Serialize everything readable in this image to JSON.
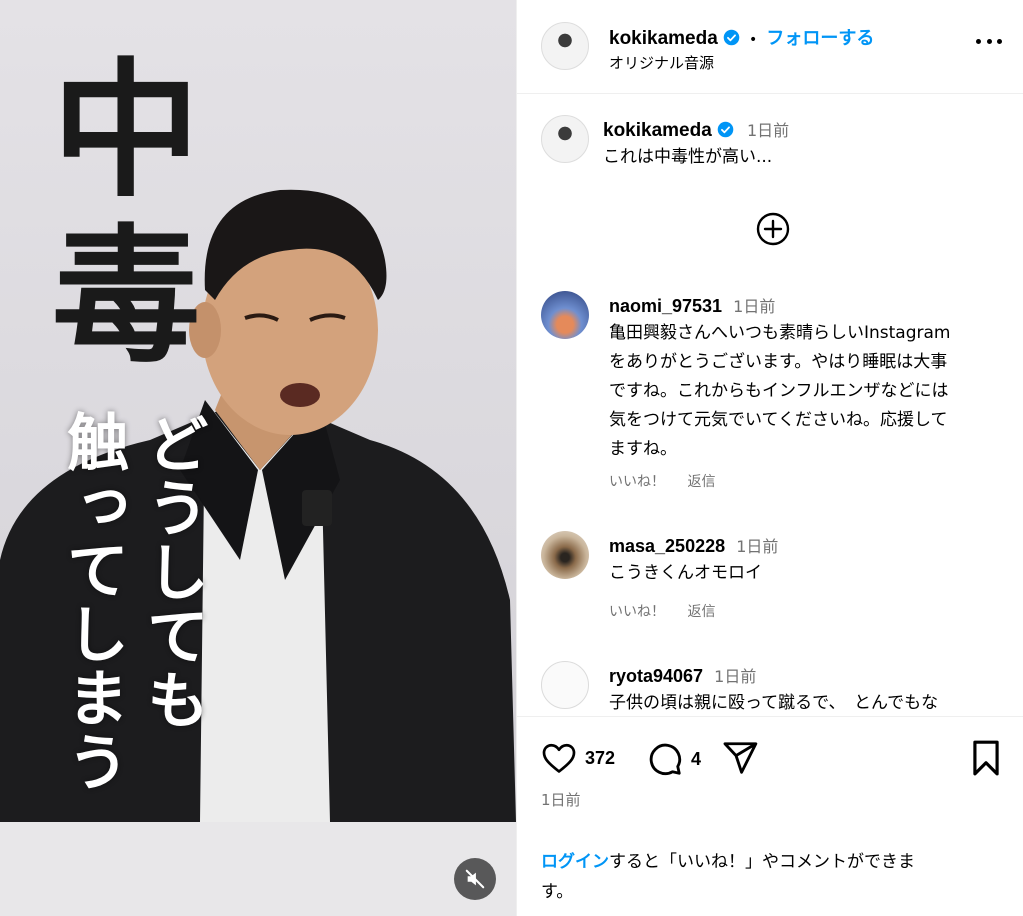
{
  "media": {
    "overlay_big_1": "中",
    "overlay_big_2": "毒",
    "overlay_vertical_1": "触ってしまう",
    "overlay_vertical_2": "どうしても"
  },
  "header": {
    "username": "kokikameda",
    "separator": "•",
    "follow_label": "フォローする",
    "audio_label": "オリジナル音源"
  },
  "caption": {
    "username": "kokikameda",
    "time": "1日前",
    "text": "これは中毒性が高い..."
  },
  "comments": [
    {
      "username": "naomi_97531",
      "time": "1日前",
      "lines": [
        "亀田興毅さんへいつも素晴らしいInstagram",
        "をありがとうございます。やはり睡眠は大事",
        "ですね。これからもインフルエンザなどには",
        "気をつけて元気でいてくださいね。応援して",
        "ますね。"
      ],
      "like_label": "いいね！",
      "reply_label": "返信"
    },
    {
      "username": "masa_250228",
      "time": "1日前",
      "lines": [
        "こうきくんオモロイ"
      ],
      "like_label": "いいね！",
      "reply_label": "返信"
    },
    {
      "username": "ryota94067",
      "time": "1日前",
      "lines": [
        "子供の頃は親に殴って蹴るで、　とんでもな"
      ]
    }
  ],
  "actions": {
    "like_count": "372",
    "comment_count": "4",
    "date": "1日前",
    "login_link": "ログイン",
    "login_text_1": "すると「いいね！」やコメントができま",
    "login_text_2": "す。"
  },
  "colors": {
    "link": "#0095f6",
    "muted": "#737373",
    "divider": "#efefef"
  }
}
